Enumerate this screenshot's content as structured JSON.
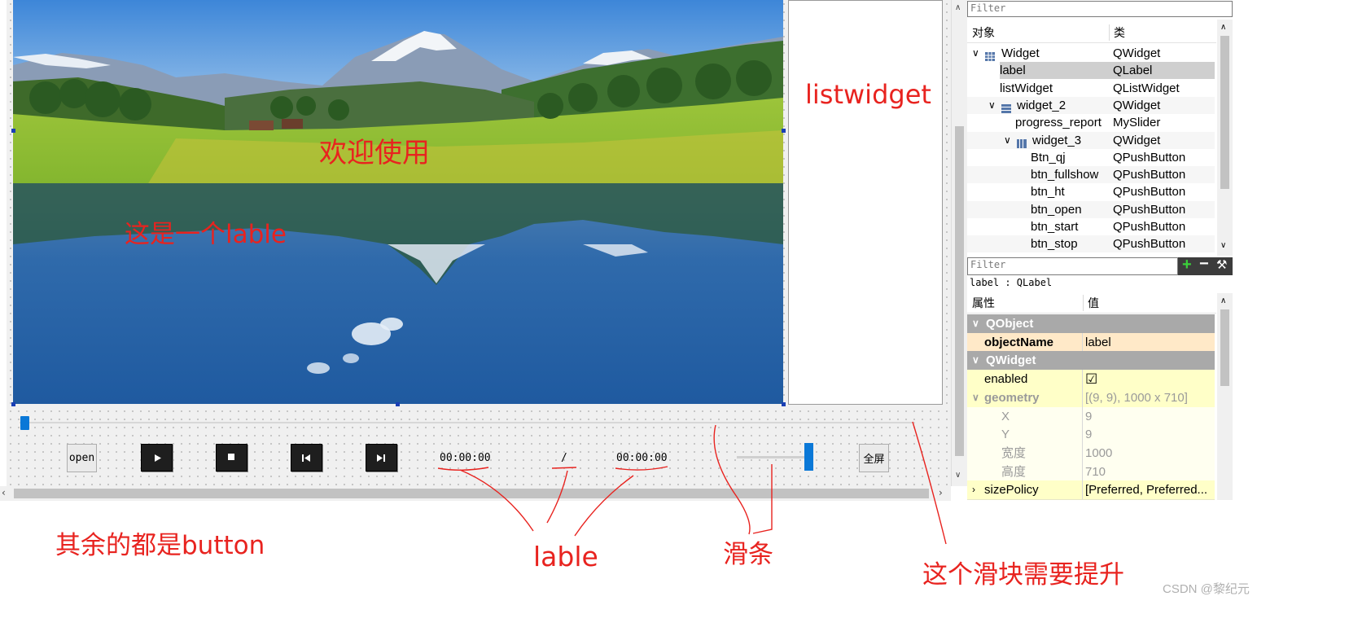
{
  "designer": {
    "welcome_text": "欢迎使用",
    "label_note": "这是一个lable",
    "listwidget_text": "listwidget",
    "open_button": "open",
    "time_current": "00:00:00",
    "time_separator": "/",
    "time_total": "00:00:00",
    "fullscreen_button": "全屏",
    "volume_level": 0.85,
    "progress_level": 0.0
  },
  "annotations": {
    "rest_are_buttons": "其余的都是button",
    "lable": "lable",
    "slider": "滑条",
    "slider_needs_raise": "这个滑块需要提升",
    "watermark": "CSDN @黎纪元"
  },
  "object_inspector": {
    "filter_placeholder": "Filter",
    "header_object": "对象",
    "header_class": "类",
    "rows": [
      {
        "name": "Widget",
        "cls": "QWidget",
        "arrow": "∨",
        "icon": "grid"
      },
      {
        "name": "label",
        "cls": "QLabel",
        "arrow": "",
        "icon": ""
      },
      {
        "name": "listWidget",
        "cls": "QListWidget",
        "arrow": "",
        "icon": ""
      },
      {
        "name": "widget_2",
        "cls": "QWidget",
        "arrow": "∨",
        "icon": "vlayout"
      },
      {
        "name": "progress_report",
        "cls": "MySlider",
        "arrow": "",
        "icon": ""
      },
      {
        "name": "widget_3",
        "cls": "QWidget",
        "arrow": "∨",
        "icon": "hlayout"
      },
      {
        "name": "Btn_qj",
        "cls": "QPushButton",
        "arrow": "",
        "icon": ""
      },
      {
        "name": "btn_fullshow",
        "cls": "QPushButton",
        "arrow": "",
        "icon": ""
      },
      {
        "name": "btn_ht",
        "cls": "QPushButton",
        "arrow": "",
        "icon": ""
      },
      {
        "name": "btn_open",
        "cls": "QPushButton",
        "arrow": "",
        "icon": ""
      },
      {
        "name": "btn_start",
        "cls": "QPushButton",
        "arrow": "",
        "icon": ""
      },
      {
        "name": "btn_stop",
        "cls": "QPushButton",
        "arrow": "",
        "icon": ""
      }
    ]
  },
  "property_editor": {
    "filter_placeholder": "Filter",
    "subject": "label : QLabel",
    "header_property": "属性",
    "header_value": "值",
    "rows": [
      {
        "kind": "section",
        "name": "QObject",
        "value": ""
      },
      {
        "kind": "prop",
        "name": "objectName",
        "value": "label",
        "bold": true
      },
      {
        "kind": "section",
        "name": "QWidget",
        "value": ""
      },
      {
        "kind": "prop",
        "name": "enabled",
        "value": "☑"
      },
      {
        "kind": "expand",
        "name": "geometry",
        "value": "[(9, 9), 1000 x 710]"
      },
      {
        "kind": "sub",
        "name": "X",
        "value": "9"
      },
      {
        "kind": "sub",
        "name": "Y",
        "value": "9"
      },
      {
        "kind": "sub",
        "name": "宽度",
        "value": "1000"
      },
      {
        "kind": "sub",
        "name": "高度",
        "value": "710"
      },
      {
        "kind": "collapsed",
        "name": "sizePolicy",
        "value": "[Preferred, Preferred..."
      }
    ]
  },
  "colors": {
    "annotation_red": "#e8231f",
    "section_gray": "#a9a9a9",
    "highlight_yellow": "#ffffc8",
    "selected_row": "#cfcfcf",
    "accent_blue": "#0a78d7"
  }
}
